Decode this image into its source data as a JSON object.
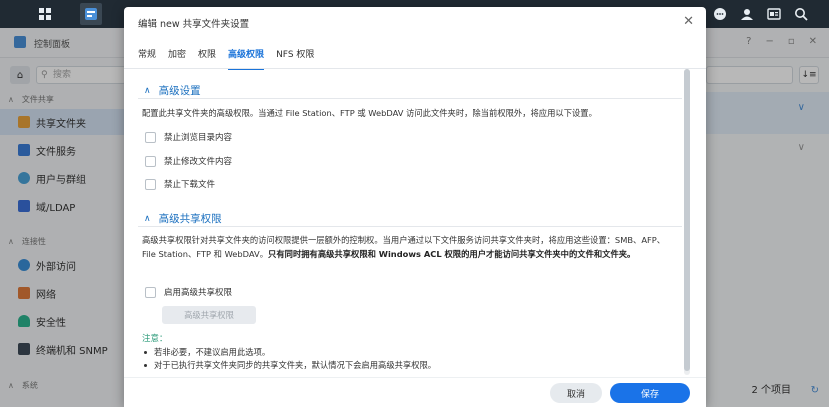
{
  "control_panel": {
    "title": "控制面板",
    "search_placeholder": "搜索",
    "sections": [
      {
        "label": "文件共享"
      },
      {
        "label": "连接性"
      },
      {
        "label": "系统"
      }
    ],
    "nav": [
      {
        "label": "共享文件夹",
        "active": true
      },
      {
        "label": "文件服务"
      },
      {
        "label": "用户与群组"
      },
      {
        "label": "域/LDAP"
      },
      {
        "label": "外部访问"
      },
      {
        "label": "网络"
      },
      {
        "label": "安全性"
      },
      {
        "label": "终端机和 SNMP"
      }
    ],
    "item_count": "2 个项目"
  },
  "dialog": {
    "title": "编辑 new 共享文件夹设置",
    "tabs": [
      {
        "label": "常规"
      },
      {
        "label": "加密"
      },
      {
        "label": "权限"
      },
      {
        "label": "高级权限",
        "active": true
      },
      {
        "label": "NFS 权限"
      }
    ],
    "advanced_settings": {
      "heading": "高级设置",
      "description": "配置此共享文件夹的高级权限。当通过 File Station、FTP 或 WebDAV 访问此文件夹时，除当前权限外，将应用以下设置。",
      "options": [
        {
          "label": "禁止浏览目录内容",
          "checked": false
        },
        {
          "label": "禁止修改文件内容",
          "checked": false
        },
        {
          "label": "禁止下载文件",
          "checked": false
        }
      ]
    },
    "advanced_share_permissions": {
      "heading": "高级共享权限",
      "description_plain": "高级共享权限针对共享文件夹的访问权限提供一层额外的控制权。当用户通过以下文件服务访问共享文件夹时，将应用这些设置：SMB、AFP、File Station、FTP 和 WebDAV。",
      "description_bold": "只有同时拥有高级共享权限和 Windows ACL 权限的用户才能访问共享文件夹中的文件和文件夹。",
      "enable_label": "启用高级共享权限",
      "enable_checked": false,
      "button_label": "高级共享权限"
    },
    "note": {
      "title": "注意：",
      "items": [
        "若非必要，不建议启用此选项。",
        "对于已执行共享文件夹同步的共享文件夹，默认情况下会启用高级共享权限。"
      ]
    },
    "buttons": {
      "cancel": "取消",
      "save": "保存"
    },
    "close_icon": "close-icon"
  },
  "taskbar": {
    "icons": [
      "grid-icon",
      "control-panel-icon",
      "chat-icon",
      "user-icon",
      "widgets-icon",
      "search-icon"
    ]
  }
}
